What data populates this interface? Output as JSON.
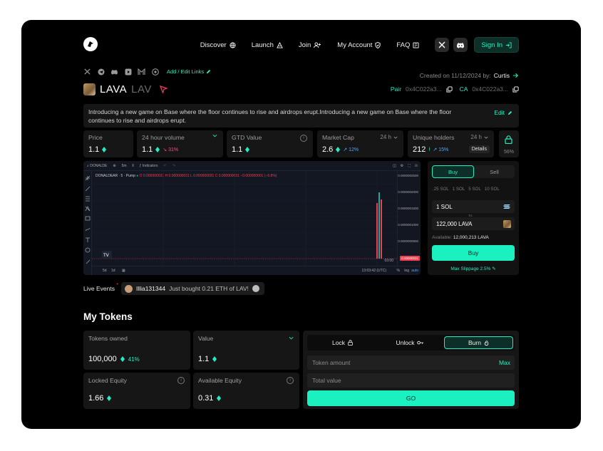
{
  "nav": {
    "items": [
      {
        "label": "Discover",
        "icon": "globe-icon"
      },
      {
        "label": "Launch",
        "icon": "launch-icon"
      },
      {
        "label": "Join",
        "icon": "users-icon"
      },
      {
        "label": "My Account",
        "icon": "shield-icon"
      },
      {
        "label": "FAQ",
        "icon": "book-icon"
      }
    ],
    "signin_label": "Sign In"
  },
  "socials": {
    "icons": [
      "x-icon",
      "telegram-icon",
      "discord-icon",
      "youtube-icon",
      "gitbook-icon",
      "reddit-icon"
    ],
    "add_links_label": "Add / Edit Links"
  },
  "token": {
    "name": "LAVA",
    "symbol": "LAV",
    "created_prefix": "Created on 11/12/2024 by:",
    "creator": "Curtis",
    "pair_label": "Pair",
    "pair_value": "0x4C022a3...",
    "ca_label": "CA",
    "ca_value": "0x4C022a3...",
    "description": "Introducing a new game on Base where the floor continues to rise and airdrops erupt.Introducing a new game on Base where the floor continues to rise and airdrops erupt.",
    "edit_label": "Edit"
  },
  "stats": {
    "price": {
      "label": "Price",
      "value": "1.1"
    },
    "volume": {
      "label": "24 hour volume",
      "value": "1.1",
      "change": "31%"
    },
    "gtd": {
      "label": "GTD Value",
      "value": "1.1"
    },
    "mcap": {
      "label": "Market Cap",
      "value": "2.6",
      "change": "12%",
      "period": "24 h"
    },
    "holders": {
      "label": "Unique holders",
      "value": "212",
      "change": "15%",
      "period": "24 h",
      "details_label": "Details"
    },
    "locked_pct": "56%"
  },
  "chart": {
    "symbol_label": "DONALDE",
    "interval": "5m",
    "indicators_label": "Indicators",
    "title": "DONALDEAR · 5 · Pump",
    "ohlc": "O 0.000000031  H 0.000000031  L 0.000000031  C 0.000000031  −0.000000001 (−6.8%)",
    "time_label": "03:00",
    "clock": "13:03:42 (UTC)",
    "price_tag": "0.00000031",
    "ylabels": [
      "0.0000002500",
      "0.0000002000",
      "0.0000001500",
      "0.0000001000",
      "0.0000000500"
    ],
    "ranges": [
      "5d",
      "1d"
    ],
    "bottom_right": [
      "%",
      "log",
      "auto"
    ]
  },
  "buy_panel": {
    "buy_tab": "Buy",
    "sell_tab": "Sell",
    "presets": [
      ".25 SOL",
      "1 SOL",
      "5 SOL",
      "10 SOL"
    ],
    "pay_value": "1 SOL",
    "to_label": "TO",
    "receive_value": "122,000 LAVA",
    "available_label": "Available:",
    "available_value": "12,000,213 LAVA",
    "buy_button": "Buy",
    "slippage_label": "Max Slippage 2.5%"
  },
  "live_events": {
    "label": "Live Events",
    "user": "Illia131344",
    "message": "Just bought 0.21 ETH of LAV!"
  },
  "my_tokens": {
    "title": "My Tokens",
    "owned": {
      "label": "Tokens owned",
      "value": "100,000",
      "change": "41%"
    },
    "value": {
      "label": "Value",
      "value": "1.1"
    },
    "locked": {
      "label": "Locked Equity",
      "value": "1.66"
    },
    "available": {
      "label": "Available Equity",
      "value": "0.31"
    }
  },
  "actions": {
    "lock_tab": "Lock",
    "unlock_tab": "Unlock",
    "burn_tab": "Burn",
    "amount_placeholder": "Token amount",
    "max_label": "Max",
    "total_placeholder": "Total value",
    "go_label": "GO"
  },
  "colors": {
    "accent": "#20f0c4",
    "up": "#4aa8ff",
    "down": "#ff4d7d",
    "candle_red": "#ef3f4f",
    "candle_green": "#26a69a"
  }
}
